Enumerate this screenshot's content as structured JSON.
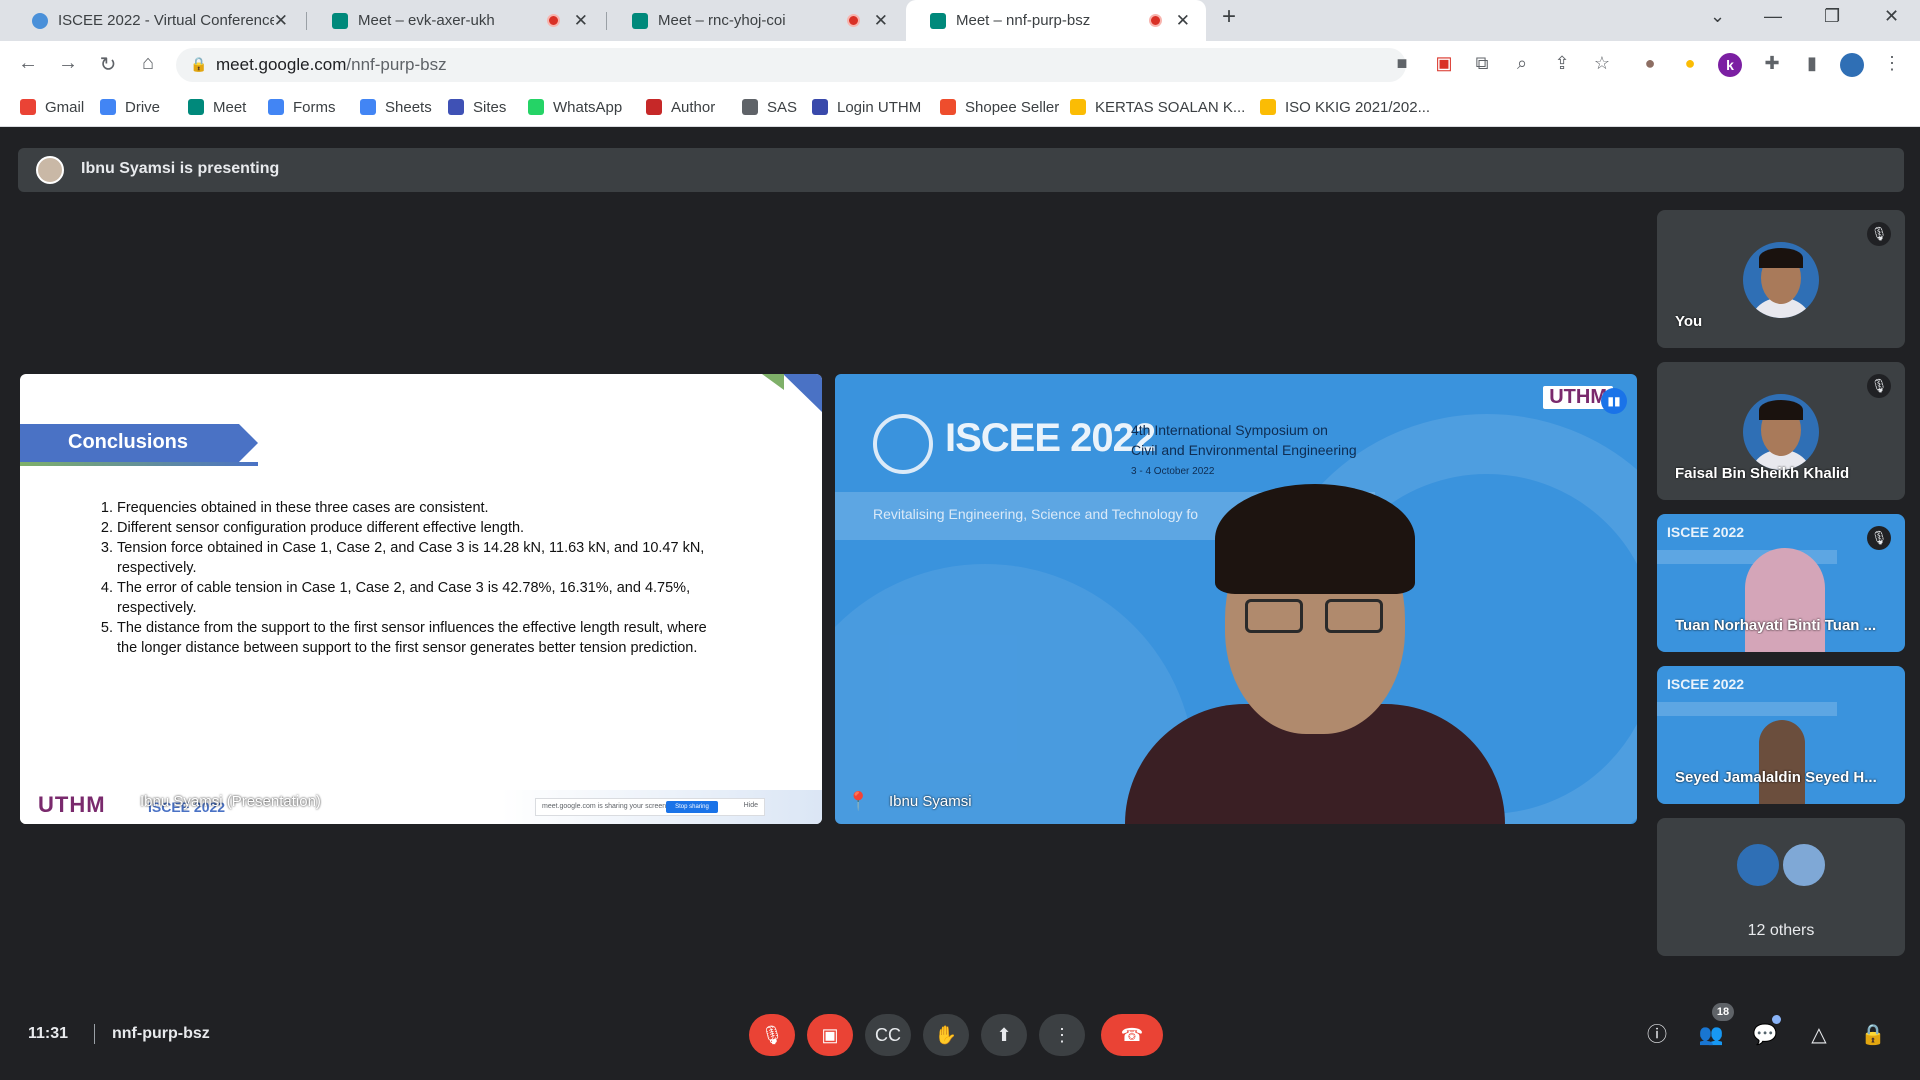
{
  "browser": {
    "tabs": [
      {
        "label": "ISCEE 2022 - Virtual Conference",
        "recording": false,
        "active": false
      },
      {
        "label": "Meet – evk-axer-ukh",
        "recording": true,
        "active": false
      },
      {
        "label": "Meet – rnc-yhoj-coi",
        "recording": true,
        "active": false
      },
      {
        "label": "Meet – nnf-purp-bsz",
        "recording": true,
        "active": true
      }
    ],
    "url_host": "meet.google.com",
    "url_path": "/nnf-purp-bsz",
    "bookmarks": [
      {
        "label": "Gmail",
        "icon": "gmail-icon",
        "color": "#ea4335"
      },
      {
        "label": "Drive",
        "icon": "google-icon",
        "color": "#4285f4"
      },
      {
        "label": "Meet",
        "icon": "meet-icon",
        "color": "#00897b"
      },
      {
        "label": "Forms",
        "icon": "google-icon",
        "color": "#4285f4"
      },
      {
        "label": "Sheets",
        "icon": "google-icon",
        "color": "#4285f4"
      },
      {
        "label": "Sites",
        "icon": "sites-icon",
        "color": "#3f51b5"
      },
      {
        "label": "WhatsApp",
        "icon": "whatsapp-icon",
        "color": "#25d366"
      },
      {
        "label": "Author",
        "icon": "author-icon",
        "color": "#c62828"
      },
      {
        "label": "SAS",
        "icon": "globe-icon",
        "color": "#5f6368"
      },
      {
        "label": "Login UTHM",
        "icon": "uthm-icon",
        "color": "#3949ab"
      },
      {
        "label": "Shopee Seller",
        "icon": "shopee-icon",
        "color": "#ee4d2d"
      },
      {
        "label": "KERTAS SOALAN K...",
        "icon": "drive-icon",
        "color": "#fbbc04"
      },
      {
        "label": "ISO KKIG 2021/202...",
        "icon": "drive-icon",
        "color": "#fbbc04"
      }
    ]
  },
  "meet": {
    "presenting_label": "Ibnu Syamsi is presenting",
    "slide": {
      "heading": "Conclusions",
      "items": [
        "Frequencies obtained in these three cases are consistent.",
        "Different sensor configuration produce different effective length.",
        "Tension force obtained in Case 1, Case 2, and Case 3 is 14.28 kN, 11.63 kN, and 10.47 kN, respectively.",
        "The error of cable tension in Case 1, Case 2, and Case 3 is 42.78%, 16.31%, and 4.75%, respectively.",
        "The distance from the support to the first sensor influences the effective length result, where the longer distance between support to the first sensor generates better tension prediction."
      ],
      "footer_logo": "UTHM",
      "footer_logo2": "ISCEE 2022",
      "presentation_name": "Ibnu Syamsi (Presentation)",
      "share_notice": "meet.google.com is sharing your screen.",
      "stop_sharing": "Stop sharing",
      "hide": "Hide"
    },
    "camera": {
      "banner_title": "ISCEE 2022",
      "symposium_line1": "4th International Symposium on",
      "symposium_line2": "Civil and Environmental Engineering",
      "symposium_dates": "3 - 4 October 2022",
      "tagline": "Revitalising Engineering, Science and Technology fo",
      "uthm": "UTHM",
      "name": "Ibnu Syamsi"
    },
    "participants": [
      {
        "name": "You",
        "muted": true,
        "type": "avatar"
      },
      {
        "name": "Faisal Bin Sheikh Khalid",
        "muted": true,
        "type": "avatar"
      },
      {
        "name": "Tuan Norhayati Binti Tuan ...",
        "muted": true,
        "type": "video"
      },
      {
        "name": "Seyed Jamalaldin Seyed H...",
        "muted": false,
        "type": "video"
      }
    ],
    "others_label": "12 others",
    "time": "11:31",
    "meeting_code": "nnf-purp-bsz",
    "participant_count": "18"
  }
}
